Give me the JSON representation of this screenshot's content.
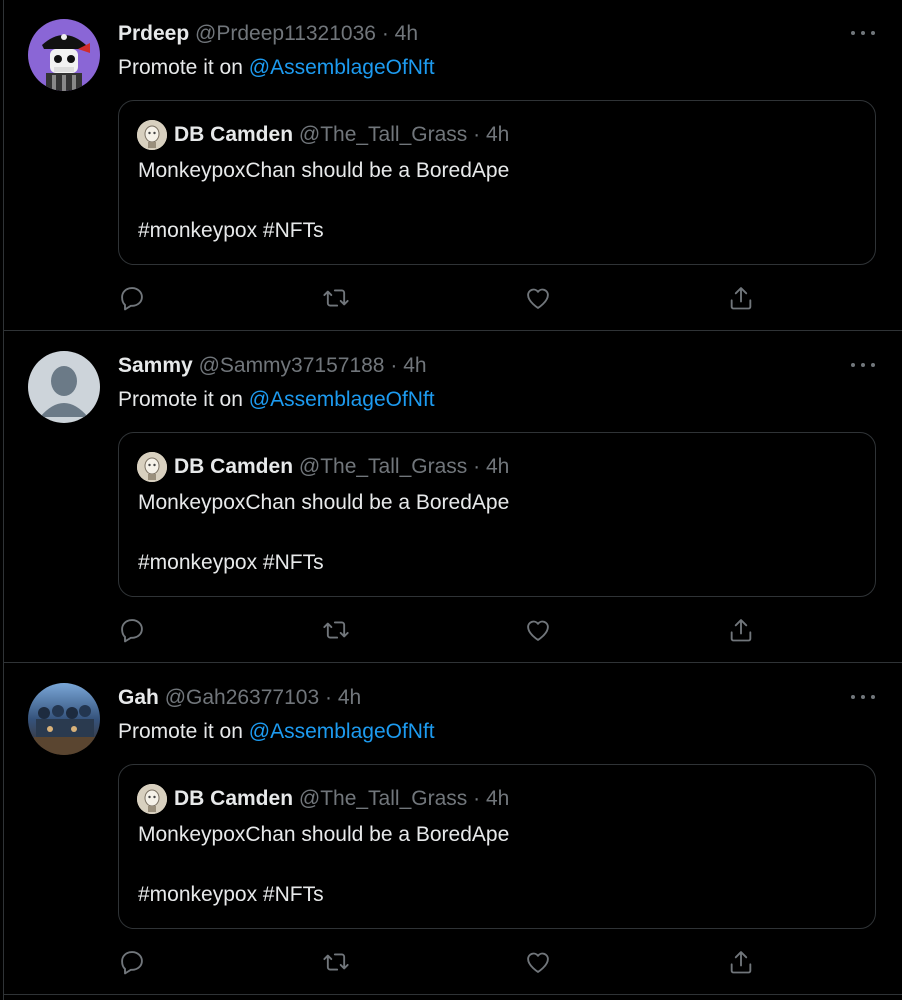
{
  "colors": {
    "background": "#000000",
    "text": "#e7e9ea",
    "muted": "#71767b",
    "link": "#1d9bf0",
    "border": "#2f3336"
  },
  "tweets": [
    {
      "name": "Prdeep",
      "handle": "@Prdeep11321036",
      "dot": "·",
      "time": "4h",
      "text": "Promote it on",
      "mention": "@AssemblageOfNft",
      "avatar": "pirate-skull-avatar",
      "quote": {
        "name": "DB Camden",
        "handle": "@The_Tall_Grass",
        "dot": "·",
        "time": "4h",
        "text": "MonkeypoxChan should be a BoredApe",
        "tags": "#monkeypox #NFTs"
      }
    },
    {
      "name": "Sammy",
      "handle": "@Sammy37157188",
      "dot": "·",
      "time": "4h",
      "text": "Promote it on",
      "mention": "@AssemblageOfNft",
      "avatar": "default-avatar",
      "quote": {
        "name": "DB Camden",
        "handle": "@The_Tall_Grass",
        "dot": "·",
        "time": "4h",
        "text": "MonkeypoxChan should be a BoredApe",
        "tags": "#monkeypox #NFTs"
      }
    },
    {
      "name": "Gah",
      "handle": "@Gah26377103",
      "dot": "·",
      "time": "4h",
      "text": "Promote it on",
      "mention": "@AssemblageOfNft",
      "avatar": "group-photo-avatar",
      "quote": {
        "name": "DB Camden",
        "handle": "@The_Tall_Grass",
        "dot": "·",
        "time": "4h",
        "text": "MonkeypoxChan should be a BoredApe",
        "tags": "#monkeypox #NFTs"
      }
    }
  ],
  "actions": [
    "reply-icon",
    "retweet-icon",
    "like-icon",
    "share-icon"
  ]
}
